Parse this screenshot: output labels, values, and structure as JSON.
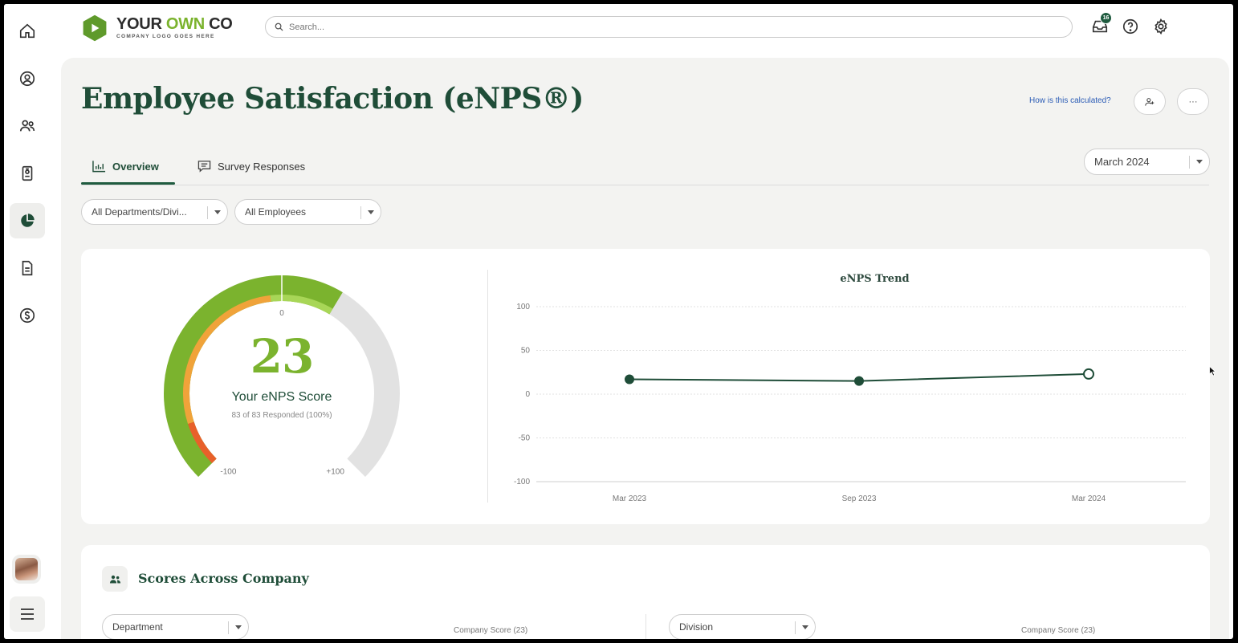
{
  "logo": {
    "name_part1": "YOUR",
    "name_part2": "OWN",
    "name_part3": "CO",
    "tagline": "COMPANY LOGO GOES HERE"
  },
  "search": {
    "placeholder": "Search..."
  },
  "notifications": {
    "count": "16"
  },
  "page": {
    "title": "Employee Satisfaction (eNPS®)",
    "help_link": "How is this calculated?",
    "more_label": "···"
  },
  "tabs": [
    {
      "label": "Overview"
    },
    {
      "label": "Survey Responses"
    }
  ],
  "filters": {
    "period": "March 2024",
    "department": "All Departments/Divi...",
    "employees": "All Employees"
  },
  "gauge": {
    "score": "23",
    "score_value": 23,
    "label": "Your eNPS Score",
    "responded": "83 of 83 Responded (100%)",
    "center_tick": "0",
    "min_label": "-100",
    "max_label": "+100"
  },
  "chart_data": {
    "type": "line",
    "title": "eNPS Trend",
    "categories": [
      "Mar 2023",
      "Sep 2023",
      "Mar 2024"
    ],
    "values": [
      17,
      15,
      23
    ],
    "ylim": [
      -100,
      100
    ],
    "yticks": [
      "100",
      "50",
      "0",
      "-50",
      "-100"
    ],
    "grid": true,
    "xlabel": "",
    "ylabel": ""
  },
  "scores_section": {
    "title": "Scores Across Company",
    "left_dropdown": "Department",
    "left_company_score": "Company Score (23)",
    "right_dropdown": "Division",
    "right_company_score": "Company Score (23)"
  },
  "colors": {
    "brand_dark": "#1f4d38",
    "brand_green": "#7bb32e",
    "link": "#2a5bb5",
    "gauge_gray": "#e2e2e2",
    "gauge_orange": "#f0a33a",
    "gauge_red": "#e8602a"
  }
}
